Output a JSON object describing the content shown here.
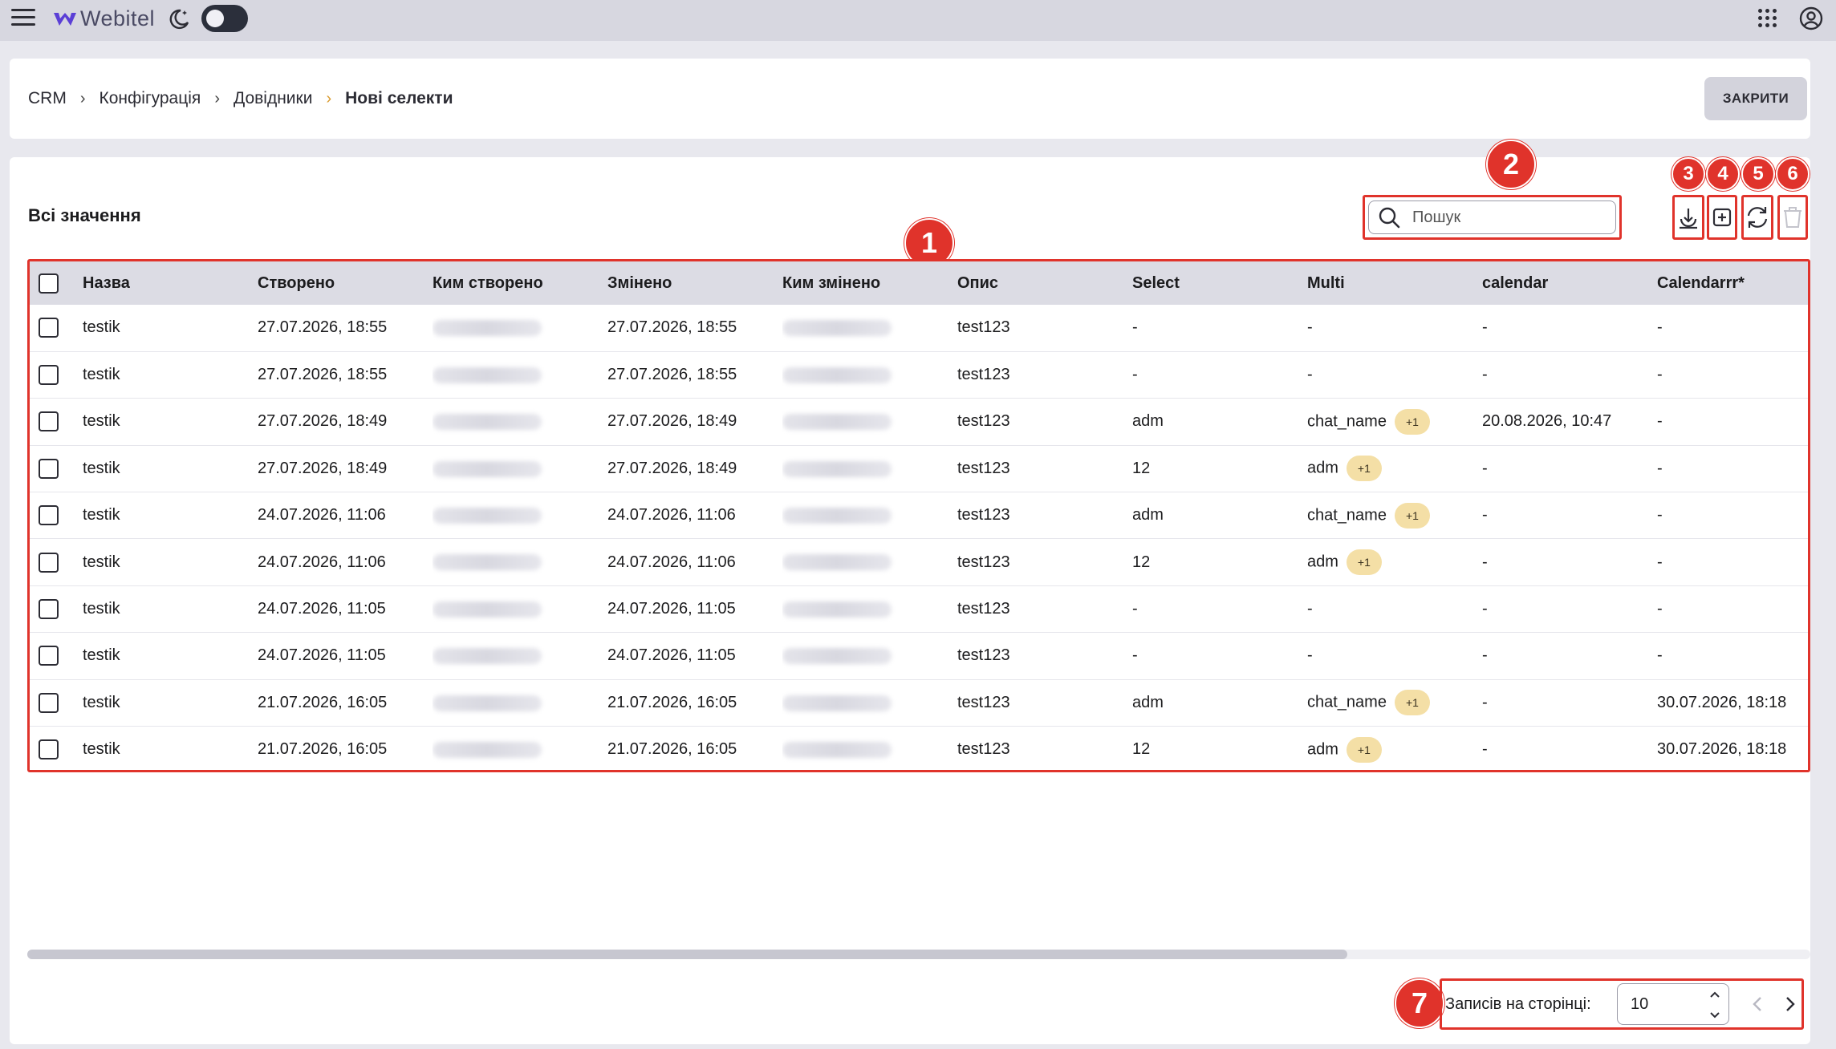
{
  "app": {
    "brand": "Webitel"
  },
  "breadcrumb": {
    "items": [
      "CRM",
      "Конфігурація",
      "Довідники"
    ],
    "current": "Нові селекти"
  },
  "header": {
    "close_label": "ЗАКРИТИ"
  },
  "section": {
    "title": "Всі значення"
  },
  "search": {
    "placeholder": "Пошук"
  },
  "toolbar": {
    "icons": [
      "download-icon",
      "add-icon",
      "refresh-icon",
      "delete-icon"
    ]
  },
  "annotations": [
    "1",
    "2",
    "3",
    "4",
    "5",
    "6",
    "7"
  ],
  "table": {
    "columns": [
      "Назва",
      "Створено",
      "Ким створено",
      "Змінено",
      "Ким змінено",
      "Опис",
      "Select",
      "Multi",
      "calendar",
      "Calendarrr*"
    ],
    "rows": [
      {
        "name": "testik",
        "created": "27.07.2026, 18:55",
        "modified": "27.07.2026, 18:55",
        "description": "test123",
        "select": "-",
        "multi": "-",
        "multi_extra": "",
        "calendar": "-",
        "calendarrr": "-"
      },
      {
        "name": "testik",
        "created": "27.07.2026, 18:55",
        "modified": "27.07.2026, 18:55",
        "description": "test123",
        "select": "-",
        "multi": "-",
        "multi_extra": "",
        "calendar": "-",
        "calendarrr": "-"
      },
      {
        "name": "testik",
        "created": "27.07.2026, 18:49",
        "modified": "27.07.2026, 18:49",
        "description": "test123",
        "select": "adm",
        "multi": "chat_name",
        "multi_extra": "+1",
        "calendar": "20.08.2026, 10:47",
        "calendarrr": "-"
      },
      {
        "name": "testik",
        "created": "27.07.2026, 18:49",
        "modified": "27.07.2026, 18:49",
        "description": "test123",
        "select": "12",
        "multi": "adm",
        "multi_extra": "+1",
        "calendar": "-",
        "calendarrr": "-"
      },
      {
        "name": "testik",
        "created": "24.07.2026, 11:06",
        "modified": "24.07.2026, 11:06",
        "description": "test123",
        "select": "adm",
        "multi": "chat_name",
        "multi_extra": "+1",
        "calendar": "-",
        "calendarrr": "-"
      },
      {
        "name": "testik",
        "created": "24.07.2026, 11:06",
        "modified": "24.07.2026, 11:06",
        "description": "test123",
        "select": "12",
        "multi": "adm",
        "multi_extra": "+1",
        "calendar": "-",
        "calendarrr": "-"
      },
      {
        "name": "testik",
        "created": "24.07.2026, 11:05",
        "modified": "24.07.2026, 11:05",
        "description": "test123",
        "select": "-",
        "multi": "-",
        "multi_extra": "",
        "calendar": "-",
        "calendarrr": "-"
      },
      {
        "name": "testik",
        "created": "24.07.2026, 11:05",
        "modified": "24.07.2026, 11:05",
        "description": "test123",
        "select": "-",
        "multi": "-",
        "multi_extra": "",
        "calendar": "-",
        "calendarrr": "-"
      },
      {
        "name": "testik",
        "created": "21.07.2026, 16:05",
        "modified": "21.07.2026, 16:05",
        "description": "test123",
        "select": "adm",
        "multi": "chat_name",
        "multi_extra": "+1",
        "calendar": "-",
        "calendarrr": "30.07.2026, 18:18"
      },
      {
        "name": "testik",
        "created": "21.07.2026, 16:05",
        "modified": "21.07.2026, 16:05",
        "description": "test123",
        "select": "12",
        "multi": "adm",
        "multi_extra": "+1",
        "calendar": "-",
        "calendarrr": "30.07.2026, 18:18"
      }
    ]
  },
  "pagination": {
    "label": "Записів на сторінці:",
    "page_size": "10"
  },
  "colors": {
    "annotation": "#e0332b",
    "chip": "#f4dfa6",
    "header_row": "#dcdce4",
    "topbar": "#d7d7e0"
  }
}
